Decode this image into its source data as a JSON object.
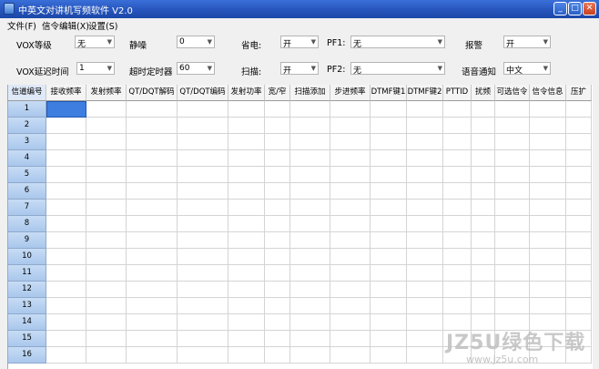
{
  "window": {
    "title": "中英文对讲机写频软件 V2.0",
    "min_symbol": "_",
    "max_symbol": "□",
    "close_symbol": "✕"
  },
  "menu": [
    {
      "label": "文件(F)"
    },
    {
      "label": "信令编辑(X)"
    },
    {
      "label": "设置(S)"
    }
  ],
  "settings": {
    "vox_level": {
      "label": "VOX等级",
      "value": "无"
    },
    "squelch": {
      "label": "静噪",
      "value": "0"
    },
    "power_save": {
      "label": "省电:",
      "value": "开"
    },
    "pf1": {
      "label": "PF1:",
      "value": "无"
    },
    "alarm": {
      "label": "报警",
      "value": "开"
    },
    "vox_delay": {
      "label": "VOX延迟时间",
      "value": "1"
    },
    "timeout": {
      "label": "超时定时器",
      "value": "60"
    },
    "scan": {
      "label": "扫描:",
      "value": "开"
    },
    "pf2": {
      "label": "PF2:",
      "value": "无"
    },
    "voice": {
      "label": "语音通知",
      "value": "中文"
    }
  },
  "table": {
    "columns": [
      "信道编号",
      "接收频率",
      "发射频率",
      "QT/DQT解码",
      "QT/DQT编码",
      "发射功率",
      "宽/窄",
      "扫描添加",
      "步进频率",
      "DTMF键1",
      "DTMF键2",
      "PTTID",
      "扰频",
      "可选信令",
      "信令信息",
      "压扩"
    ],
    "rows": [
      "1",
      "2",
      "3",
      "4",
      "5",
      "6",
      "7",
      "8",
      "9",
      "10",
      "11",
      "12",
      "13",
      "14",
      "15",
      "16"
    ]
  },
  "watermark": {
    "line1": "JZ5U绿色下载",
    "line2": "www.jz5u.com"
  },
  "icons": {
    "dropdown": "▼"
  }
}
